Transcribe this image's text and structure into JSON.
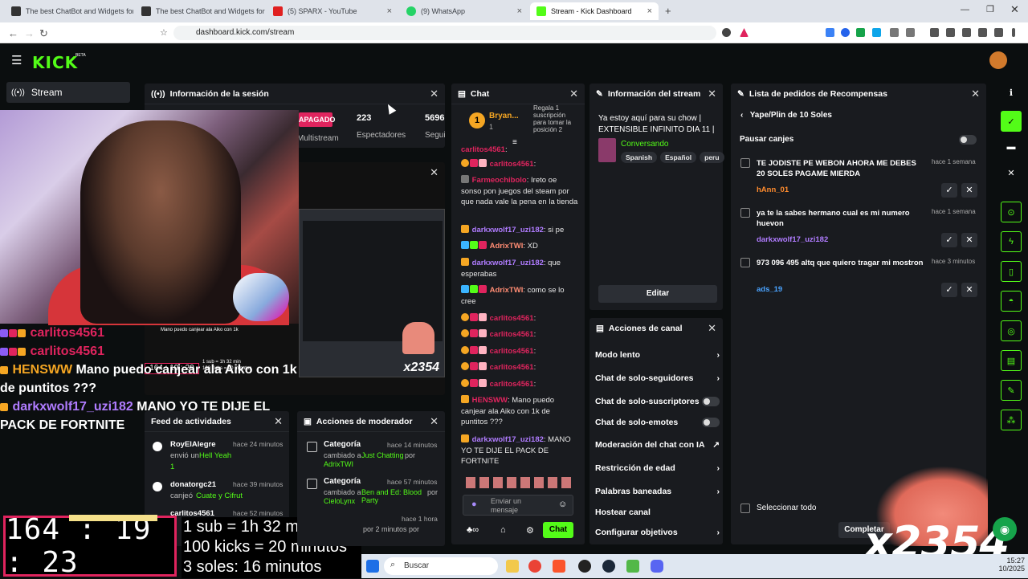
{
  "browser": {
    "tabs": [
      {
        "label": "The best ChatBot and Widgets for K"
      },
      {
        "label": "The best ChatBot and Widgets for K"
      },
      {
        "label": "(5) SPARX - YouTube"
      },
      {
        "label": "(9) WhatsApp"
      },
      {
        "label": "Stream - Kick Dashboard"
      }
    ],
    "url": "dashboard.kick.com/stream"
  },
  "nav": {
    "logo": "KICK",
    "beta": "BETA"
  },
  "sidebar": {
    "stream": "Stream"
  },
  "session": {
    "title": "Información de la sesión",
    "status": "APAGADO",
    "status_sub": "Multistream",
    "viewers": "223",
    "viewers_label": "Espectadores",
    "followers": "5696",
    "followers_label": "Segui"
  },
  "overlay": {
    "lines": [
      {
        "user": "carlitos4561",
        "text": ""
      },
      {
        "user": "carlitos4561",
        "text": ""
      },
      {
        "user": "HENSWW",
        "text": " Mano puedo canjear ala Aiko con 1k de puntitos ???"
      },
      {
        "user": "darkxwolf17_uzi182",
        "text": " MANO YO TE DIJE EL PACK DE FORTNITE"
      }
    ],
    "timer": "164 : 19 : 23",
    "mini_timer": "164 : 19 : 29",
    "rules": [
      "1 sub = 1h 32 min",
      "100 kicks = 20 minutos",
      "3 soles: 16 minutos"
    ],
    "x2354": "x2354",
    "mini_caption": "Mano puedo canjear ala Aiko con 1k",
    "mini_sub": "1 sub = 1h 32 min",
    "mini_kicks": "100 kicks = 20 minutos"
  },
  "activity": {
    "title": "Feed de actividades",
    "items": [
      {
        "user": "RoyElAlegre",
        "time": "hace 24 minutos",
        "text": "envió un",
        "item": "Hell Yeah",
        "count": "1"
      },
      {
        "user": "donatorgc21",
        "time": "hace 39 minutos",
        "text": "canjeó",
        "item": "Cuate y Cifrut"
      },
      {
        "user": "carlitos4561",
        "time": "hace 52 minutos"
      }
    ]
  },
  "moderator": {
    "title": "Acciones de moderador",
    "items": [
      {
        "label": "Categoría",
        "time": "hace 14 minutos",
        "text": "cambiado a",
        "cat": "Just Chatting",
        "by": "por",
        "user": "AdrixTWI"
      },
      {
        "label": "Categoría",
        "time": "hace 57 minutos",
        "text": "cambiado a",
        "cat": "Ben and Ed: Blood Party",
        "by": "por",
        "user": "CieloLynx"
      },
      {
        "label": "",
        "time": "hace 1 hora",
        "text": "por 2 minutos por"
      }
    ]
  },
  "chat": {
    "title": "Chat",
    "pinned_user": "Bryan...",
    "pinned_count": "1",
    "pinned_text": "Regala 1 suscripción para tomar la posición 2",
    "messages": [
      {
        "user": "carlitos4561",
        "text": ":"
      },
      {
        "user": "Farmeochibolo",
        "text": ": Ireto oe sonso pon juegos del steam por que nada vale la pena en la tienda"
      },
      {
        "user": "darkxwolf17_uzi182",
        "text": ": si pe"
      },
      {
        "user": "AdrixTWI",
        "text": ": XD"
      },
      {
        "user": "darkxwolf17_uzi182",
        "text": ": que esperabas"
      },
      {
        "user": "AdrixTWI",
        "text": ": como se lo cree"
      },
      {
        "user": "carlitos4561",
        "text": ":"
      },
      {
        "user": "carlitos4561",
        "text": ":"
      },
      {
        "user": "carlitos4561",
        "text": ":"
      },
      {
        "user": "carlitos4561",
        "text": ":"
      },
      {
        "user": "carlitos4561",
        "text": ":"
      },
      {
        "user": "HENSWW",
        "text": ": Mano puedo canjear ala Aiko con 1k de puntitos ???"
      },
      {
        "user": "darkxwolf17_uzi182",
        "text": ": MANO YO TE DIJE EL PACK DE FORTNITE"
      }
    ],
    "input_placeholder": "Enviar un mensaje",
    "send_label": "Chat"
  },
  "stream_info": {
    "title": "Información del stream",
    "stream_title": "Ya estoy aquí para su chow | EXTENSIBLE INFINITO DIA 11 | ...",
    "category": "Conversando",
    "tags": [
      "Spanish",
      "Español",
      "peru"
    ],
    "edit_label": "Editar"
  },
  "channel_actions": {
    "title": "Acciones de canal",
    "items": [
      {
        "label": "Modo lento",
        "ctrl": "arrow"
      },
      {
        "label": "Chat de solo-seguidores",
        "ctrl": "arrow"
      },
      {
        "label": "Chat de solo-suscriptores",
        "ctrl": "toggle"
      },
      {
        "label": "Chat de solo-emotes",
        "ctrl": "toggle"
      },
      {
        "label": "Moderación del chat con IA",
        "ctrl": "ext"
      },
      {
        "label": "Restricción de edad",
        "ctrl": "arrow"
      },
      {
        "label": "Palabras baneadas",
        "ctrl": "arrow"
      },
      {
        "label": "Hostear canal",
        "ctrl": "none"
      },
      {
        "label": "Configurar objetivos",
        "ctrl": "arrow"
      }
    ]
  },
  "rewards": {
    "title": "Lista de pedidos de Recompensas",
    "back_label": "Yape/Plin de 10 Soles",
    "pause_label": "Pausar canjes",
    "items": [
      {
        "text": "TE JODISTE PE WEBON AHORA ME DEBES 20 SOLES PAGAME MIERDA",
        "time": "hace 1 semana",
        "user": "hAnn_01",
        "color": "#ff8c2e"
      },
      {
        "text": "ya te la sabes hermano cual es mi numero huevon",
        "time": "hace 1 semana",
        "user": "darkxwolf17_uzi182",
        "color": "#b07cff"
      },
      {
        "text": "973 096 495 altq que quiero tragar mi mostron",
        "time": "hace 3 minutos",
        "user": "ads_19",
        "color": "#4aa3ff"
      }
    ],
    "select_all": "Seleccionar todo",
    "complete_label": "Completar"
  },
  "taskbar": {
    "search": "Buscar",
    "time": "15:27",
    "date": "10/2025"
  },
  "colors": {
    "accent": "#53fc18",
    "bg": "#0b0e0f",
    "panel": "#191b1f"
  }
}
